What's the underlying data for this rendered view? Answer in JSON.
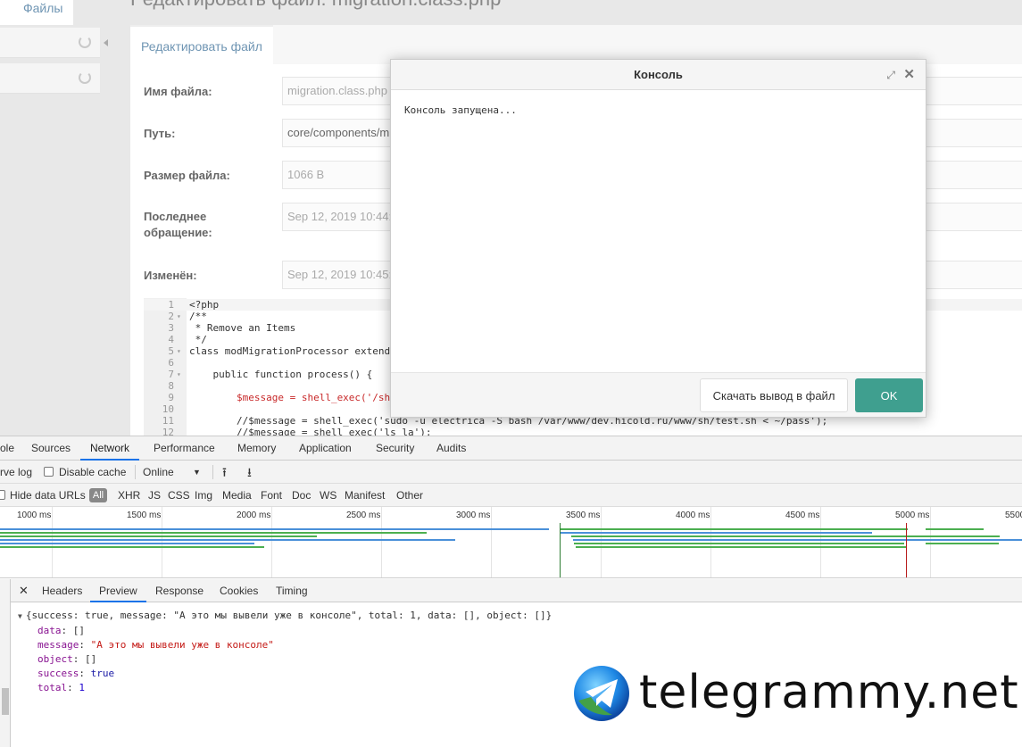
{
  "cms": {
    "files_tab": "Файлы",
    "page_title": "Редактировать файл: migration.class.php",
    "edit_tab": "Редактировать файл",
    "fields": [
      {
        "label": "Имя файла:",
        "value": "migration.class.php"
      },
      {
        "label": "Путь:",
        "value": "core/components/migration/processors/"
      },
      {
        "label": "Размер файла:",
        "value": "1066 B"
      },
      {
        "label": "Последнее обращение:",
        "value": "Sep 12, 2019 10:44:"
      },
      {
        "label": "Изменён:",
        "value": "Sep 12, 2019 10:45:"
      }
    ]
  },
  "code": {
    "lines": [
      {
        "n": "1",
        "fold": "",
        "text": "<?php"
      },
      {
        "n": "2",
        "fold": "▾",
        "text": "/**"
      },
      {
        "n": "3",
        "fold": "",
        "text": " * Remove an Items"
      },
      {
        "n": "4",
        "fold": "",
        "text": " */"
      },
      {
        "n": "5",
        "fold": "▾",
        "text": "class modMigrationProcessor extends"
      },
      {
        "n": "6",
        "fold": "",
        "text": ""
      },
      {
        "n": "7",
        "fold": "▾",
        "text": "    public function process() {"
      },
      {
        "n": "8",
        "fold": "",
        "text": ""
      },
      {
        "n": "9",
        "fold": "",
        "text": "        $message = shell_exec('/sh/"
      },
      {
        "n": "10",
        "fold": "",
        "text": ""
      },
      {
        "n": "11",
        "fold": "",
        "text": "        //$message = shell_exec('sudo -u electrica -S bash /var/www/dev.hicold.ru/www/sh/test.sh < ~/pass');"
      },
      {
        "n": "12",
        "fold": "",
        "text": "        //$message = shell_exec('ls la');"
      }
    ]
  },
  "modal": {
    "title": "Консоль",
    "expand_icon": "⤢",
    "close_icon": "✕",
    "text": "Консоль запущена...",
    "download_label": "Скачать вывод в файл",
    "ok_label": "OK"
  },
  "devtools": {
    "tabs": [
      "ole",
      "Sources",
      "Network",
      "Performance",
      "Memory",
      "Application",
      "Security",
      "Audits"
    ],
    "active_tab": "Network",
    "toolbar": {
      "preserve_log": "rve log",
      "disable_cache": "Disable cache",
      "throttle": "Online",
      "upload_icon": "⭱",
      "download_icon": "⭳"
    },
    "filter": {
      "hide_data_urls": "Hide data URLs",
      "types": [
        "All",
        "XHR",
        "JS",
        "CSS",
        "Img",
        "Media",
        "Font",
        "Doc",
        "WS",
        "Manifest",
        "Other"
      ]
    },
    "timeline_labels": [
      "1000 ms",
      "1500 ms",
      "2000 ms",
      "2500 ms",
      "3000 ms",
      "3500 ms",
      "4000 ms",
      "4500 ms",
      "5000 ms",
      "5500"
    ],
    "detail_tabs": [
      "Headers",
      "Preview",
      "Response",
      "Cookies",
      "Timing"
    ],
    "active_detail_tab": "Preview",
    "preview": {
      "summary": "{success: true, message: \"А это мы вывели уже в консоле\", total: 1, data: [], object: []}",
      "props": [
        {
          "key": "data",
          "value": "[]",
          "kind": "plain"
        },
        {
          "key": "message",
          "value": "\"А это мы вывели уже в консоле\"",
          "kind": "string"
        },
        {
          "key": "object",
          "value": "[]",
          "kind": "plain"
        },
        {
          "key": "success",
          "value": "true",
          "kind": "bool"
        },
        {
          "key": "total",
          "value": "1",
          "kind": "num"
        }
      ]
    }
  },
  "watermark": {
    "text": "telegrammy.net"
  },
  "colors": {
    "accent_teal": "#3f9f8f",
    "link_blue": "#6f95b3",
    "devtools_active": "#1a73e8"
  }
}
